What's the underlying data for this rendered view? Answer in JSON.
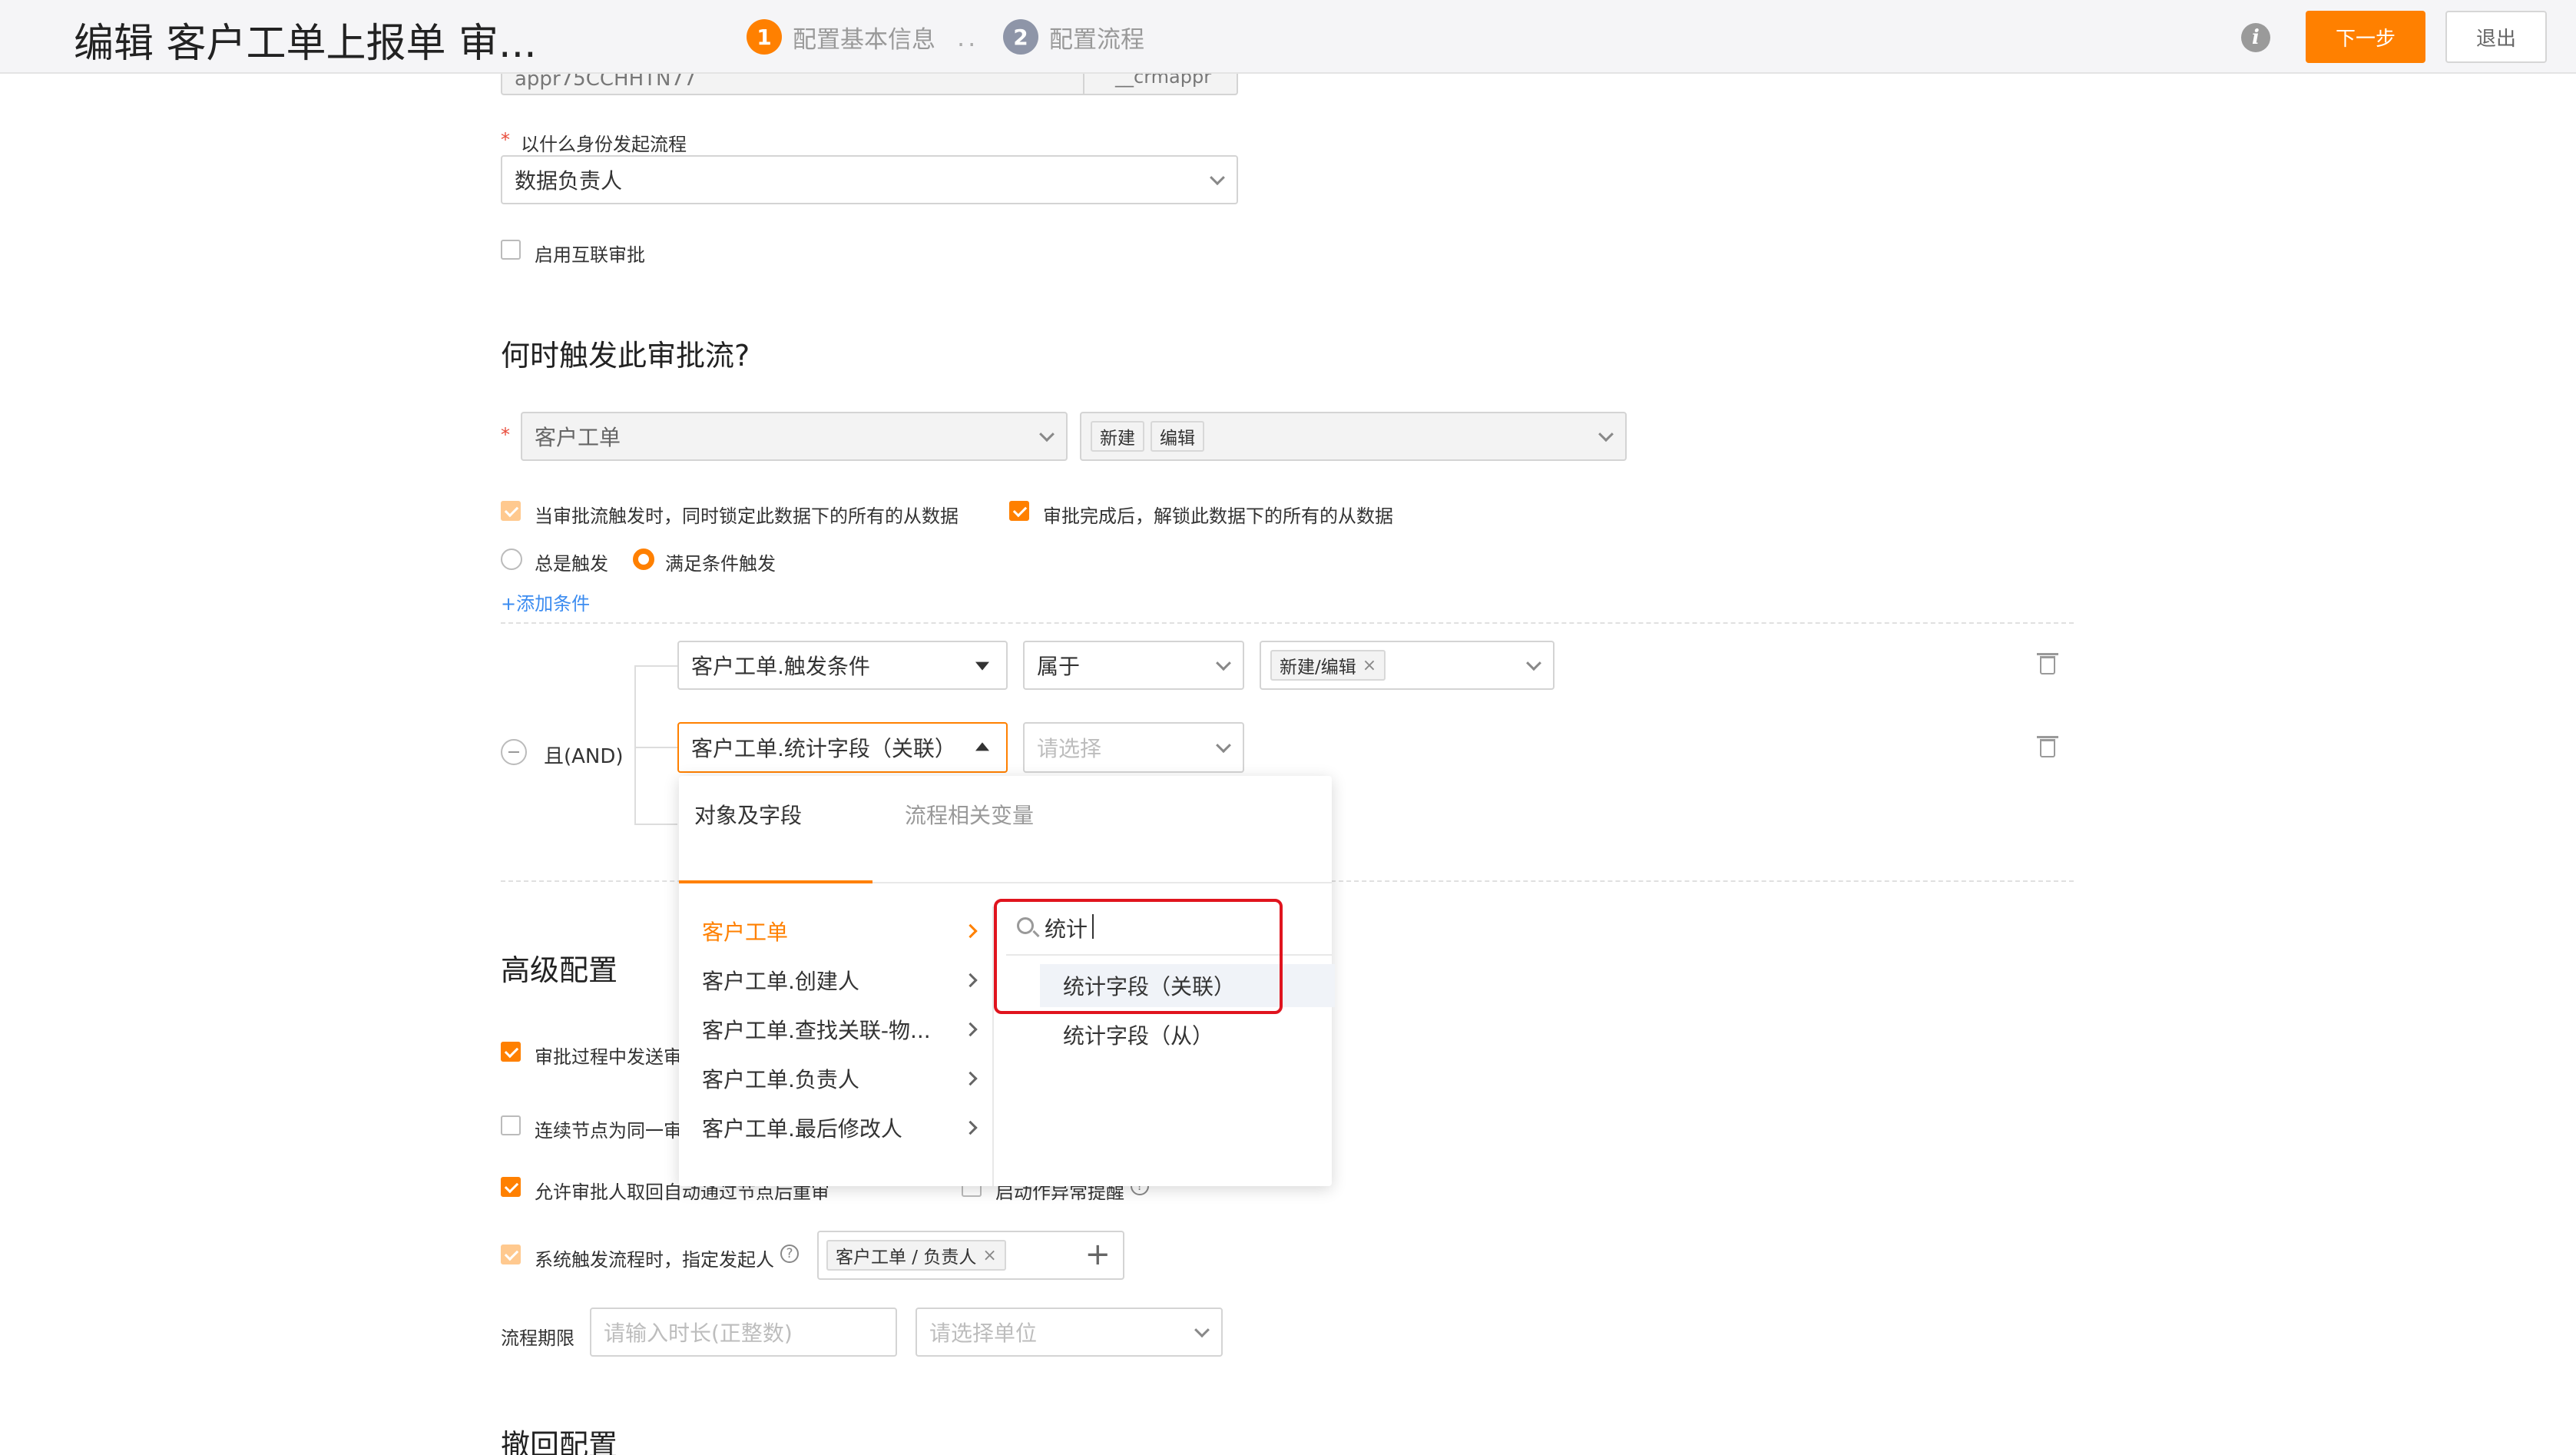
{
  "header": {
    "title": "编辑 客户工单上报单 审...",
    "steps": [
      {
        "num": "1",
        "label": "配置基本信息"
      },
      {
        "num": "2",
        "label": "配置流程"
      }
    ],
    "step_separator": "..",
    "next_label": "下一步",
    "exit_label": "退出",
    "info_glyph": "i"
  },
  "basic": {
    "api_value": "appr75CCHHTN77",
    "api_suffix": "__crmappr",
    "initiator_label": "以什么身份发起流程",
    "initiator_value": "数据负责人",
    "interconnect_label": "启用互联审批",
    "required_mark": "*"
  },
  "trigger": {
    "heading": "何时触发此审批流?",
    "object_value": "客户工单",
    "action_tags": [
      "新建",
      "编辑"
    ],
    "lock_label": "当审批流触发时，同时锁定此数据下的所有的从数据",
    "unlock_label": "审批完成后，解锁此数据下的所有的从数据",
    "radio_always": "总是触发",
    "radio_condition": "满足条件触发",
    "add_condition": "+添加条件",
    "logic_label": "且(AND)",
    "cond1": {
      "field": "客户工单.触发条件",
      "op": "属于",
      "value_tag": "新建/编辑"
    },
    "cond2": {
      "field": "客户工单.统计字段（关联）",
      "op_placeholder": "请选择"
    }
  },
  "dropdown": {
    "tabs": [
      "对象及字段",
      "流程相关变量"
    ],
    "objects": [
      "客户工单",
      "客户工单.创建人",
      "客户工单.查找关联-物...",
      "客户工单.负责人",
      "客户工单.最后修改人"
    ],
    "search_value": "统计",
    "fields": [
      "统计字段（关联）",
      "统计字段（从）"
    ]
  },
  "advanced": {
    "heading": "高级配置",
    "opt1": "审批过程中发送审",
    "opt2": "连续节点为同一审",
    "opt3": "允许审批人取回自动通过节点后重审",
    "opt3b": "启动作异常提醒",
    "opt4": "系统触发流程时，指定发起人",
    "opt4_tag": "客户工单 / 负责人",
    "period_label": "流程期限",
    "period_placeholder": "请输入时长(正整数)",
    "unit_placeholder": "请选择单位",
    "help_glyph": "?",
    "plus_glyph": "+",
    "remove_glyph": "×"
  },
  "revoke": {
    "heading": "撤回配置"
  },
  "colors": {
    "accent": "#ff8000",
    "link": "#3c8cf0",
    "highlight_box": "#e0141e",
    "step_num": "#8e95a8"
  }
}
